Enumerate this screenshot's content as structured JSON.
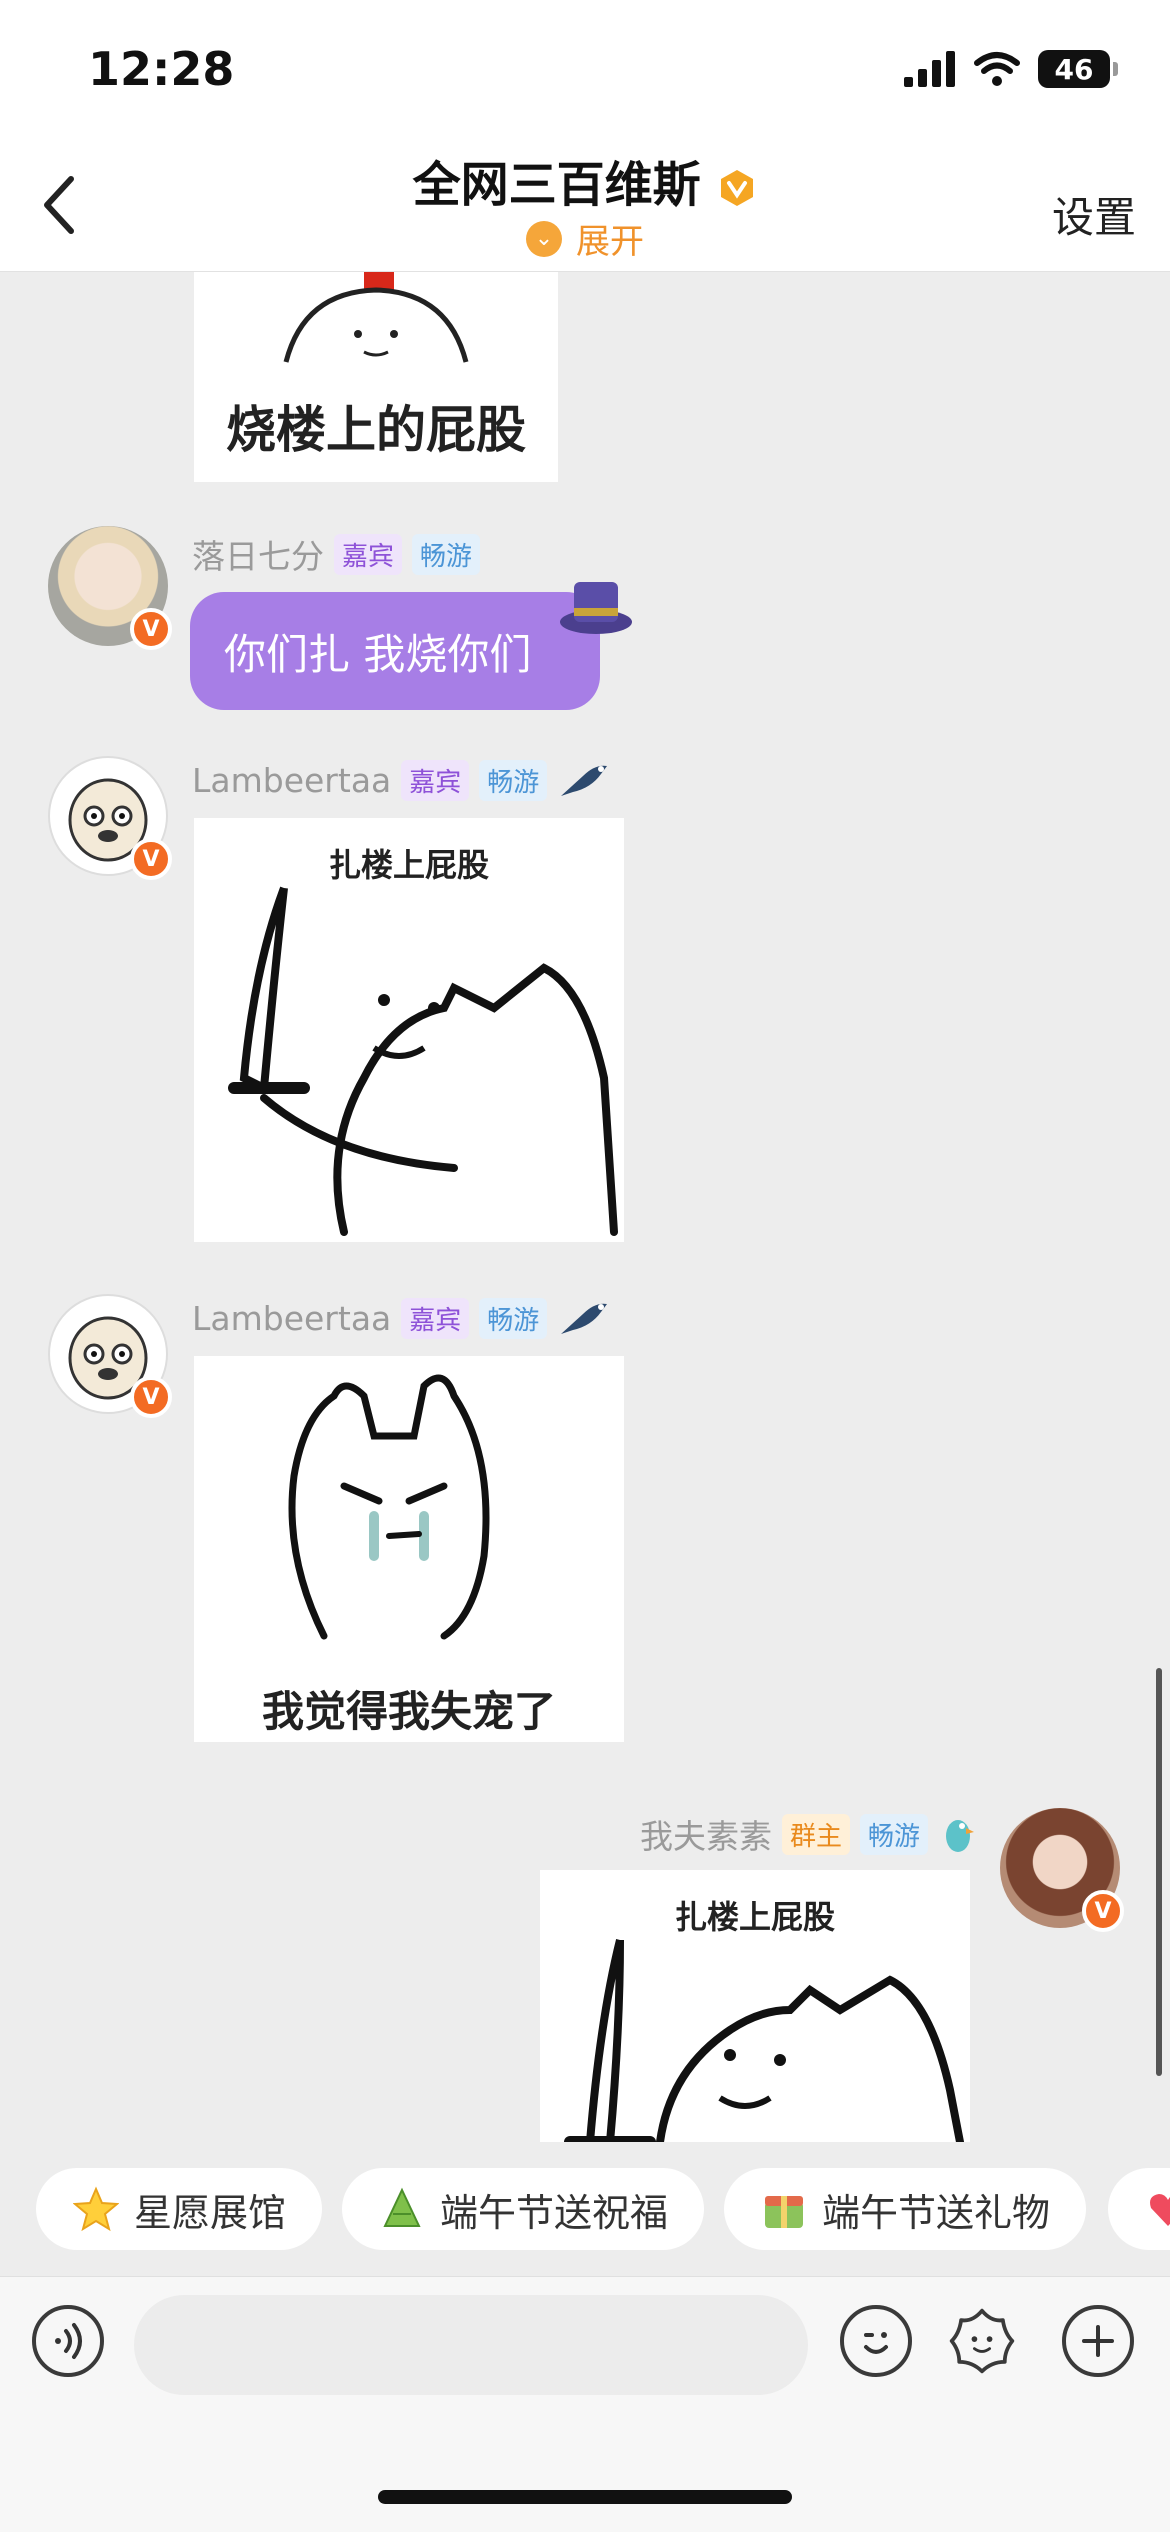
{
  "status_bar": {
    "time": "12:28",
    "battery": "46"
  },
  "header": {
    "title": "全网三百维斯",
    "expand_label": "展开",
    "settings_label": "设置"
  },
  "messages": [
    {
      "type": "image",
      "caption": "烧楼上的屁股"
    },
    {
      "type": "text",
      "sender": "落日七分",
      "tags": [
        "嘉宾",
        "畅游"
      ],
      "text": "你们扎 我烧你们"
    },
    {
      "type": "image",
      "sender": "Lambeertaa",
      "tags": [
        "嘉宾",
        "畅游"
      ],
      "caption": "扎楼上屁股"
    },
    {
      "type": "image",
      "sender": "Lambeertaa",
      "tags": [
        "嘉宾",
        "畅游"
      ],
      "caption": "我觉得我失宠了"
    },
    {
      "type": "image",
      "sender": "我夫素素",
      "tags": [
        "群主",
        "畅游"
      ],
      "caption": "扎楼上屁股"
    }
  ],
  "badge_letter": "V",
  "chips": [
    {
      "label": "星愿展馆",
      "icon": "star-icon"
    },
    {
      "label": "端午节送祝福",
      "icon": "zongzi-icon"
    },
    {
      "label": "端午节送礼物",
      "icon": "gift-icon"
    }
  ],
  "colors": {
    "accent": "#f0922b",
    "bubble": "#a77ee6",
    "guest_tag": "#8e52d8",
    "free_tag": "#4c95d6",
    "owner_tag": "#e98a1d"
  }
}
